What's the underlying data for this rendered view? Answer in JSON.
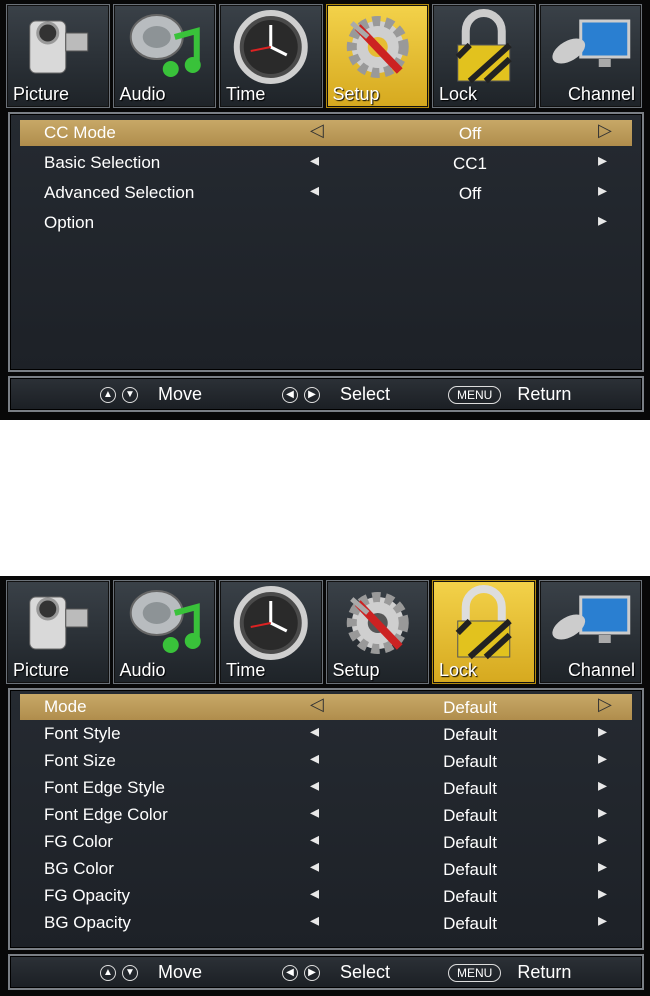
{
  "screen1": {
    "tabs": [
      {
        "label": "Picture",
        "icon": "camcorder-icon"
      },
      {
        "label": "Audio",
        "icon": "music-note-icon"
      },
      {
        "label": "Time",
        "icon": "clock-icon"
      },
      {
        "label": "Setup",
        "icon": "gear-wrench-icon",
        "active": true
      },
      {
        "label": "Lock",
        "icon": "padlock-icon"
      },
      {
        "label": "Channel",
        "icon": "tv-satellite-icon"
      }
    ],
    "rows": [
      {
        "name": "CC Mode",
        "value": "Off",
        "selected": true
      },
      {
        "name": "Basic Selection",
        "value": "CC1"
      },
      {
        "name": "Advanced Selection",
        "value": "Off"
      },
      {
        "name": "Option",
        "value": ""
      }
    ]
  },
  "screen2": {
    "tabs": [
      {
        "label": "Picture",
        "icon": "camcorder-icon"
      },
      {
        "label": "Audio",
        "icon": "music-note-icon"
      },
      {
        "label": "Time",
        "icon": "clock-icon"
      },
      {
        "label": "Setup",
        "icon": "gear-wrench-icon"
      },
      {
        "label": "Lock",
        "icon": "padlock-icon",
        "active": true
      },
      {
        "label": "Channel",
        "icon": "tv-satellite-icon"
      }
    ],
    "rows": [
      {
        "name": "Mode",
        "value": "Default",
        "selected": true
      },
      {
        "name": "Font Style",
        "value": "Default"
      },
      {
        "name": "Font Size",
        "value": "Default"
      },
      {
        "name": "Font Edge Style",
        "value": "Default"
      },
      {
        "name": "Font Edge Color",
        "value": "Default"
      },
      {
        "name": "FG Color",
        "value": "Default"
      },
      {
        "name": "BG Color",
        "value": "Default"
      },
      {
        "name": "FG Opacity",
        "value": "Default"
      },
      {
        "name": "BG Opacity",
        "value": "Default"
      }
    ]
  },
  "footer": {
    "move_label": "Move",
    "select_label": "Select",
    "menu_key": "MENU",
    "return_label": "Return"
  },
  "colors": {
    "active_tab": "#e6bd33",
    "selected_row": "#c3a262"
  }
}
